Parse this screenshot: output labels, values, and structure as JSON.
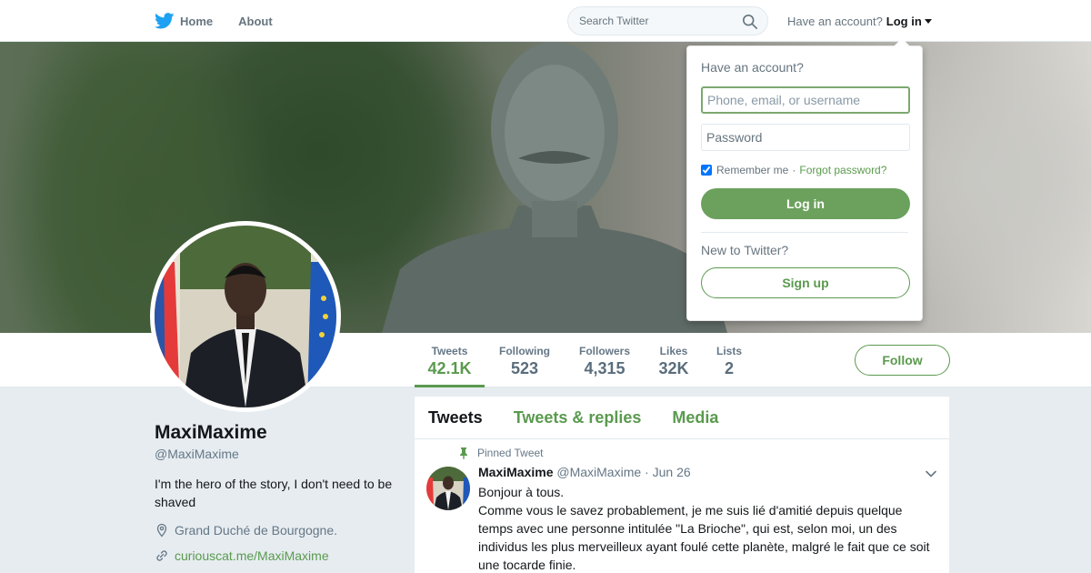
{
  "nav": {
    "home_label": "Home",
    "about_label": "About",
    "search_placeholder": "Search Twitter",
    "account_prompt": "Have an account?",
    "login_label": "Log in"
  },
  "profile": {
    "name": "MaxiMaxime",
    "handle": "@MaxiMaxime",
    "bio": "I'm the hero of the story, I don't need to be shaved",
    "location": "Grand Duché de Bourgogne.",
    "url": "curiouscat.me/MaxiMaxime"
  },
  "stats": [
    {
      "label": "Tweets",
      "value": "42.1K",
      "active": true
    },
    {
      "label": "Following",
      "value": "523"
    },
    {
      "label": "Followers",
      "value": "4,315"
    },
    {
      "label": "Likes",
      "value": "32K"
    },
    {
      "label": "Lists",
      "value": "2"
    }
  ],
  "follow_label": "Follow",
  "timeline": {
    "tabs": [
      "Tweets",
      "Tweets & replies",
      "Media"
    ],
    "pinned_label": "Pinned Tweet",
    "tweet": {
      "name": "MaxiMaxime",
      "handle": "@MaxiMaxime",
      "dot": "·",
      "date": "Jun 26",
      "line1": "Bonjour à tous.",
      "line2": "Comme vous le savez probablement, je me suis lié d'amitié depuis quelque temps avec une personne intitulée \"La Brioche\", qui est, selon moi, un des individus les plus merveilleux ayant foulé cette planète, malgré le fait que ce soit une tocarde finie."
    }
  },
  "login_dropdown": {
    "title": "Have an account?",
    "username_placeholder": "Phone, email, or username",
    "password_placeholder": "Password",
    "remember_label": "Remember me",
    "separator": "·",
    "forgot_label": "Forgot password?",
    "login_button": "Log in",
    "new_prompt": "New to Twitter?",
    "signup_button": "Sign up"
  },
  "colors": {
    "accent": "#5a9a4e",
    "twitter_blue": "#1da1f2"
  }
}
